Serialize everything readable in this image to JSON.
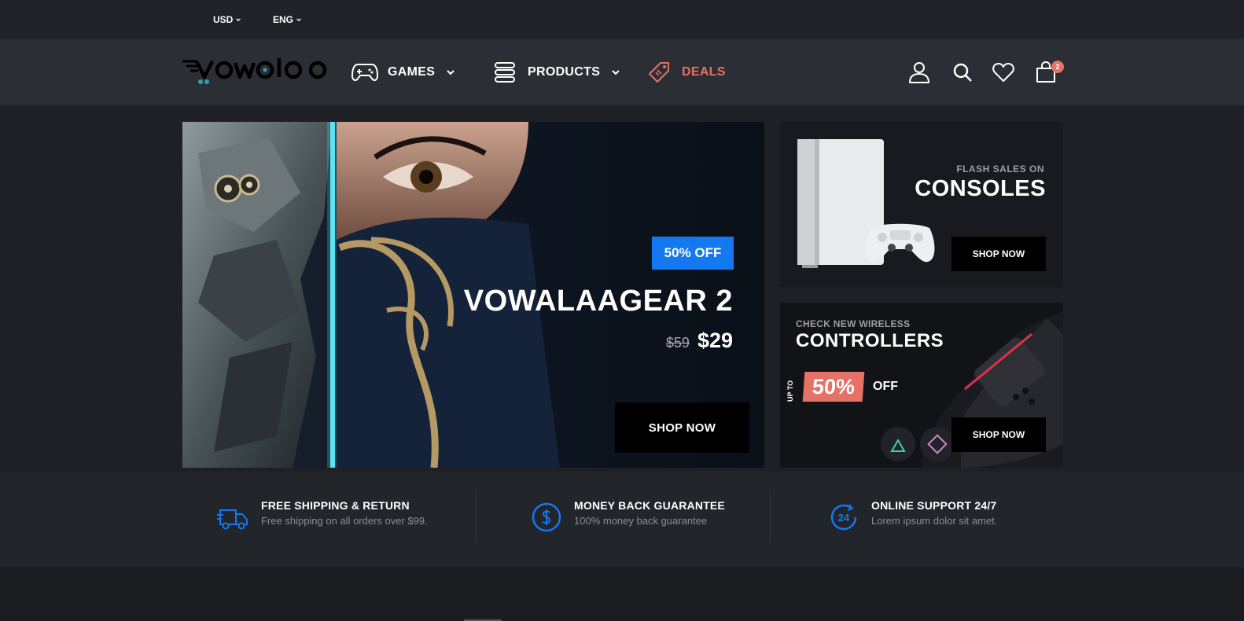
{
  "topbar": {
    "currency": "USD",
    "language": "ENG"
  },
  "nav": {
    "games": "GAMES",
    "products": "PRODUCTS",
    "deals": "DEALS",
    "deals_color": "#e57167",
    "cart_count": "2"
  },
  "hero": {
    "badge": "50% OFF",
    "title": "VOWALAAGEAR 2",
    "old_price": "$59",
    "new_price": "$29",
    "button": "SHOP NOW",
    "badge_color": "#1478f0"
  },
  "promo_consoles": {
    "subtitle": "FLASH SALES ON",
    "title": "CONSOLES",
    "button": "SHOP NOW"
  },
  "promo_controllers": {
    "subtitle": "CHECK NEW WIRELESS",
    "title": "CONTROLLERS",
    "up_to": "UP TO",
    "percent": "50%",
    "off": "OFF",
    "button": "SHOP NOW",
    "accent_color": "#e57167"
  },
  "features": [
    {
      "icon": "truck-icon",
      "title": "FREE SHIPPING & RETURN",
      "text": "Free shipping on all orders over $99."
    },
    {
      "icon": "dollar-circle-icon",
      "title": "MONEY BACK GUARANTEE",
      "text": "100% money back guarantee"
    },
    {
      "icon": "support-24-icon",
      "title": "ONLINE SUPPORT 24/7",
      "text": "Lorem ipsum dolor sit amet."
    }
  ]
}
